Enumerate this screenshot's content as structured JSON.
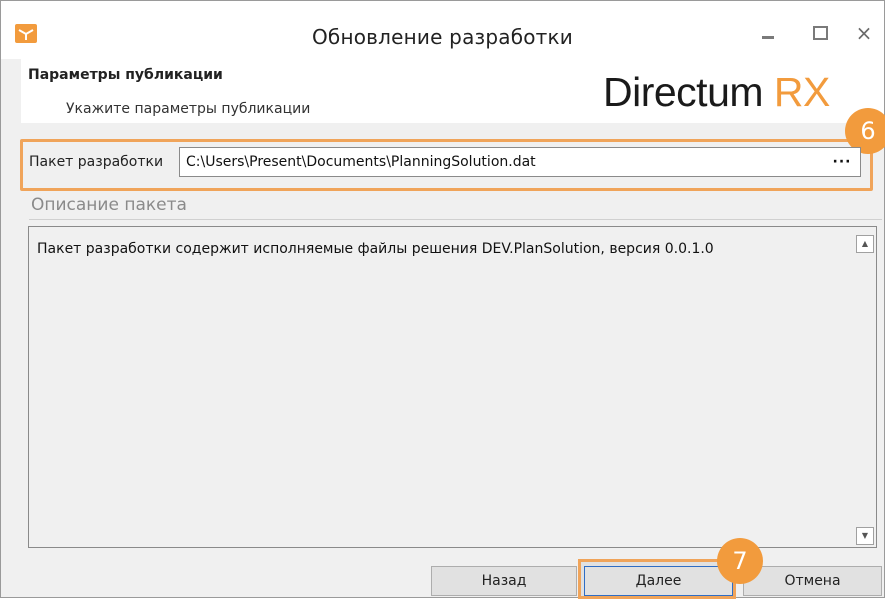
{
  "window": {
    "title": "Обновление разработки",
    "controls": {
      "minimize": "minimize",
      "maximize": "maximize",
      "close": "×"
    }
  },
  "header": {
    "title": "Параметры публикации",
    "subtitle": "Укажите параметры публикации",
    "logo_main": "Directum ",
    "logo_accent": "RX"
  },
  "form": {
    "package_label": "Пакет разработки",
    "package_path": "C:\\Users\\Present\\Documents\\PlanningSolution.dat",
    "browse_label": "···",
    "description_label": "Описание пакета",
    "description_text": "Пакет разработки содержит исполняемые файлы решения DEV.PlanSolution, версия 0.0.1.0"
  },
  "callouts": {
    "step6": "6",
    "step7": "7"
  },
  "buttons": {
    "back": "Назад",
    "next": "Далее",
    "cancel": "Отмена"
  },
  "colors": {
    "accent": "#f29b3d",
    "highlight": "#f0a45a",
    "focus": "#2f6dc4"
  },
  "icons": {
    "app": "package-box-icon",
    "scroll_up": "scroll-up-arrow-icon",
    "scroll_down": "scroll-down-arrow-icon"
  }
}
